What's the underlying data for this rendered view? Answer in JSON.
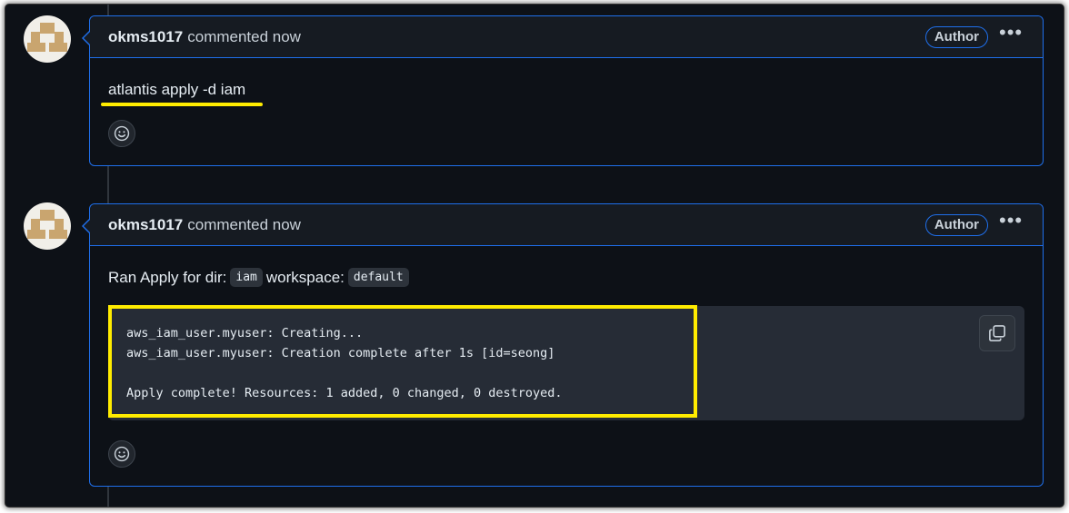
{
  "comments": [
    {
      "username": "okms1017",
      "action": "commented now",
      "badge": "Author",
      "body_text": "atlantis apply -d iam"
    },
    {
      "username": "okms1017",
      "action": "commented now",
      "badge": "Author",
      "body_prefix": "Ran Apply for dir:",
      "dir": "iam",
      "workspace_label": "workspace:",
      "workspace": "default",
      "code_lines": [
        "aws_iam_user.myuser: Creating...",
        "aws_iam_user.myuser: Creation complete after 1s [id=seong]",
        "",
        "Apply complete! Resources: 1 added, 0 changed, 0 destroyed."
      ]
    }
  ],
  "icons": {
    "more": "kebab-horizontal-icon",
    "reaction": "smiley-icon",
    "copy": "copy-icon"
  },
  "colors": {
    "background": "#0d1117",
    "accent_border": "#1f6feb",
    "highlight": "#ffec00",
    "code_bg": "#262c36"
  }
}
